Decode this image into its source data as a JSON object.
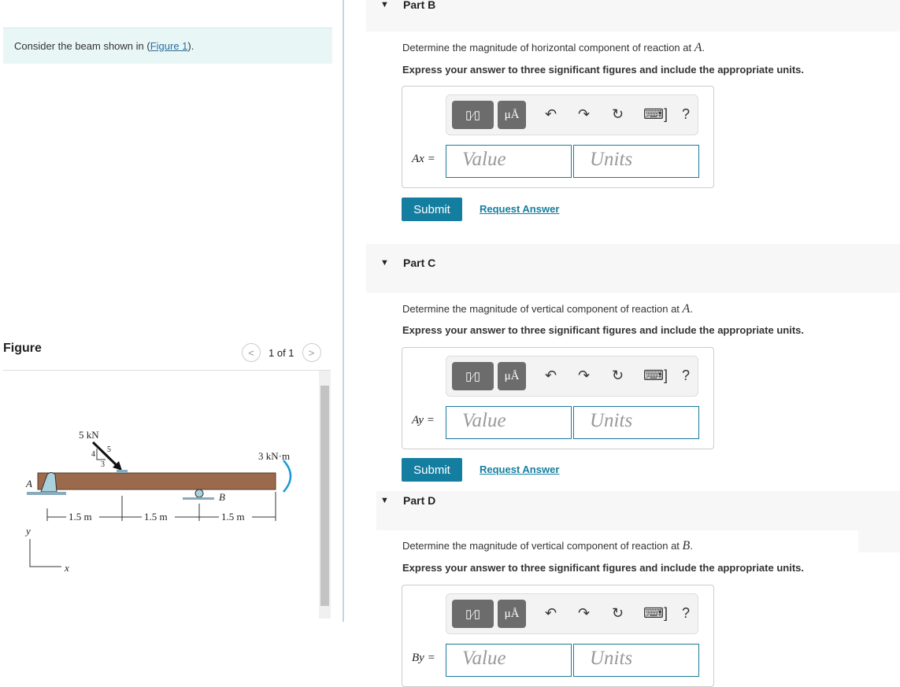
{
  "intro": {
    "text": "Consider the beam shown in (",
    "link": "Figure 1",
    "after": ")."
  },
  "figure": {
    "title": "Figure",
    "pager": "1 of 1",
    "labels": {
      "force": "5 kN",
      "slope_h": "4",
      "slope_d": "5",
      "slope_v": "3",
      "moment": "3 kN·m",
      "a": "A",
      "b": "B",
      "d1": "1.5 m",
      "d2": "1.5 m",
      "d3": "1.5 m",
      "y": "y",
      "x": "x"
    },
    "beam_color": "#9b6a4c",
    "moment_color": "#1a9ad6"
  },
  "toolbar": {
    "templates": "▯⁄▯",
    "units": "μÅ",
    "undo": "↶",
    "redo": "↷",
    "reset": "↻",
    "keyboard": "⌨]",
    "help": "?"
  },
  "parts": [
    {
      "label": "Part B",
      "question": "Determine the magnitude of horizontal component of reaction at ",
      "var_sym": "A",
      "instruction": "Express your answer to three significant figures and include the appropriate units.",
      "variable": "Ax =",
      "value_placeholder": "Value",
      "units_placeholder": "Units",
      "submit": "Submit",
      "request": "Request Answer"
    },
    {
      "label": "Part C",
      "question": "Determine the magnitude of vertical component of reaction at ",
      "var_sym": "A",
      "instruction": "Express your answer to three significant figures and include the appropriate units.",
      "variable": "Ay =",
      "value_placeholder": "Value",
      "units_placeholder": "Units",
      "submit": "Submit",
      "request": "Request Answer"
    },
    {
      "label": "Part D",
      "question": "Determine the magnitude of vertical component of reaction at ",
      "var_sym": "B",
      "instruction": "Express your answer to three significant figures and include the appropriate units.",
      "variable": "By =",
      "value_placeholder": "Value",
      "units_placeholder": "Units"
    }
  ]
}
